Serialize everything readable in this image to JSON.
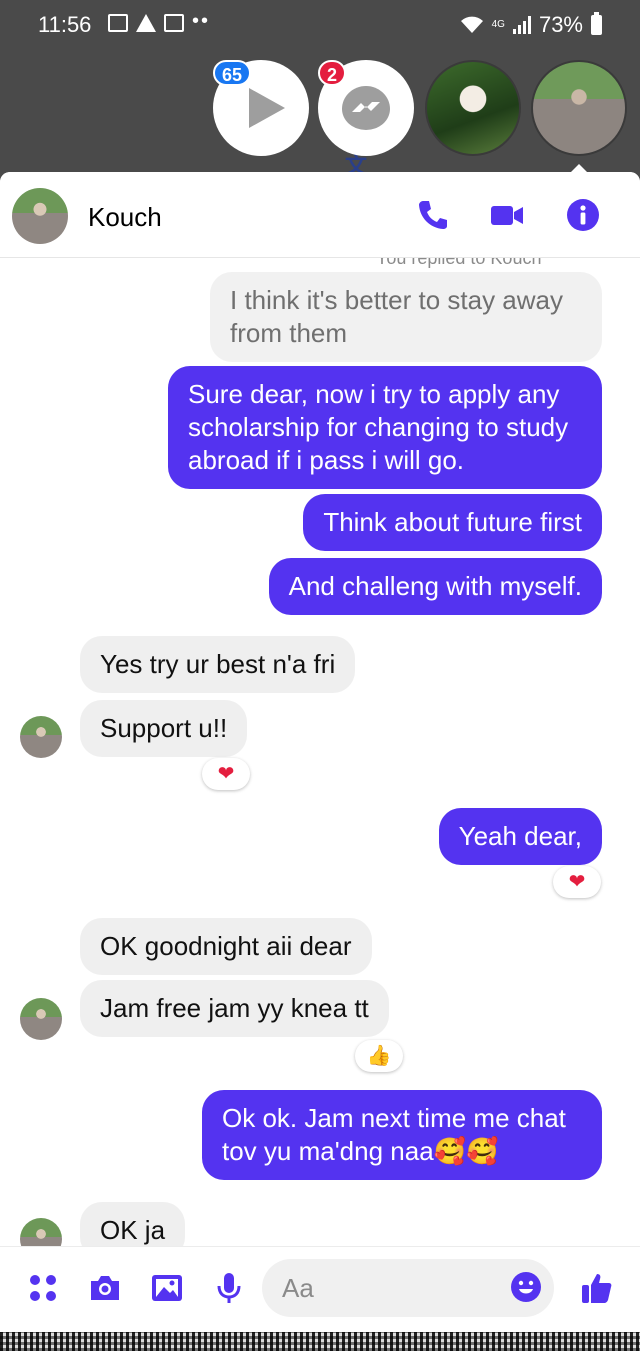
{
  "status_bar": {
    "time": "11:56",
    "network": "4G",
    "battery": "73%"
  },
  "chat_heads": {
    "badges": [
      "65",
      "2"
    ]
  },
  "header": {
    "contact_name": "Kouch"
  },
  "thread": {
    "reply_hint": "You replied to Kouch",
    "quoted": "I think it's better to stay away from them",
    "messages": [
      {
        "dir": "out",
        "text": "Sure dear, now i try to apply any scholarship for changing to study abroad if i pass i will go."
      },
      {
        "dir": "out",
        "text": "Think about future first"
      },
      {
        "dir": "out",
        "text": "And challeng with myself."
      },
      {
        "dir": "in",
        "text": "Yes try ur best n'a fri"
      },
      {
        "dir": "in",
        "text": "Support u!!",
        "reaction": "❤"
      },
      {
        "dir": "out",
        "text": "Yeah dear,",
        "reaction": "❤"
      },
      {
        "dir": "in",
        "text": "OK goodnight aii dear"
      },
      {
        "dir": "in",
        "text": "Jam free jam yy knea tt",
        "reaction": "👍"
      },
      {
        "dir": "out",
        "text": "Ok ok. Jam next time me chat tov yu ma'dng naa🥰🥰"
      },
      {
        "dir": "in",
        "text": "OK ja"
      }
    ]
  },
  "composer": {
    "placeholder": "Aa"
  },
  "colors": {
    "accent": "#5433f0",
    "incoming_bubble": "#efefef",
    "badge_blue": "#1877f2",
    "badge_red": "#e41e3f"
  },
  "icons": [
    "play-icon",
    "messenger-icon",
    "phone-icon",
    "video-camera-icon",
    "info-icon",
    "apps-icon",
    "camera-icon",
    "image-icon",
    "microphone-icon",
    "emoji-icon",
    "thumbs-up-icon"
  ]
}
